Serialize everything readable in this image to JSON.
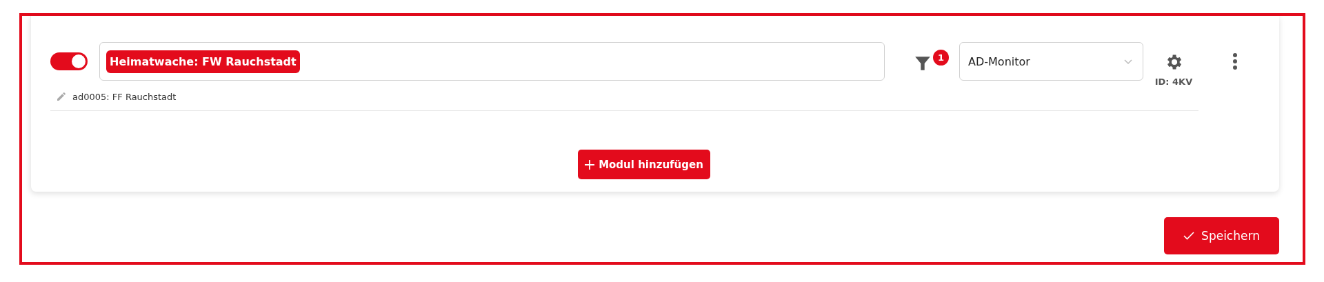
{
  "module": {
    "enabled": true,
    "title_chip": "Heimatwache: FW Rauchstadt",
    "subtitle": "ad0005: FF Rauchstadt",
    "filter_badge": "1",
    "type_select": {
      "value": "AD-Monitor"
    },
    "id_label": "ID: 4KV"
  },
  "add_button": {
    "label": "Modul hinzufügen"
  },
  "save_button": {
    "label": "Speichern"
  }
}
